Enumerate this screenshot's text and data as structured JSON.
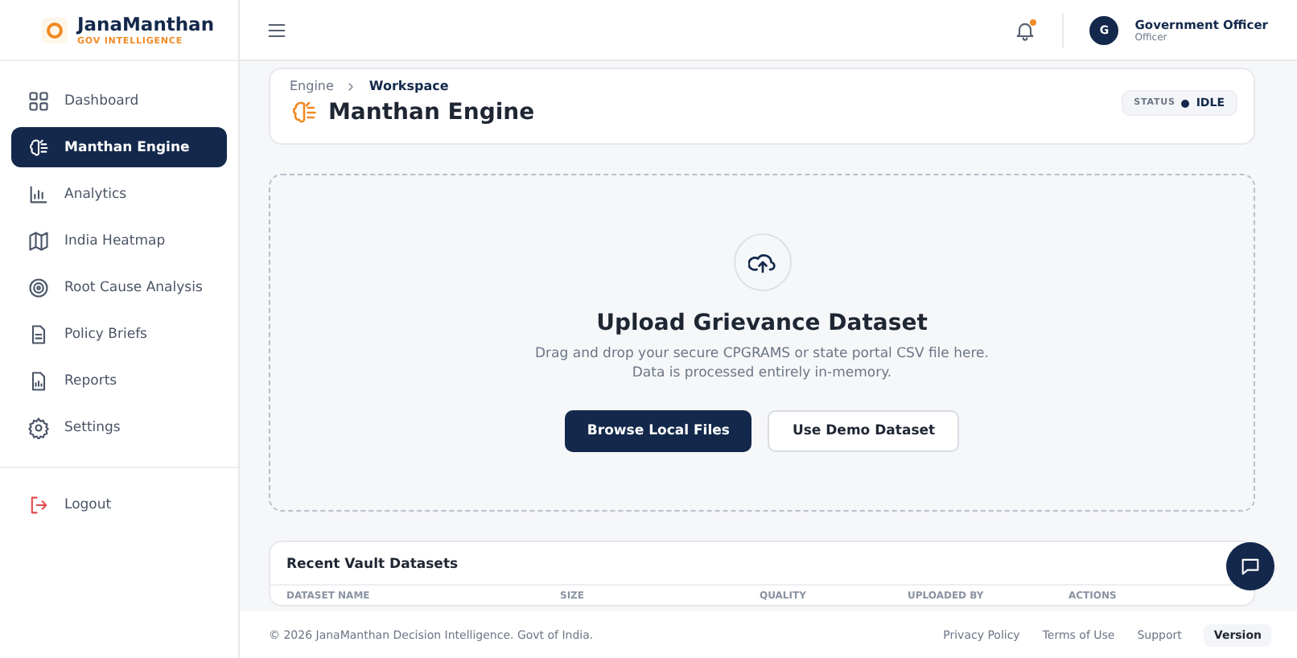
{
  "brand": {
    "name": "JanaManthan",
    "tagline": "GOV INTELLIGENCE"
  },
  "sidebar": {
    "items": [
      {
        "label": "Dashboard",
        "selected": false
      },
      {
        "label": "Manthan Engine",
        "selected": true
      },
      {
        "label": "Analytics",
        "selected": false
      },
      {
        "label": "India Heatmap",
        "selected": false
      },
      {
        "label": "Root Cause Analysis",
        "selected": false
      },
      {
        "label": "Policy Briefs",
        "selected": false
      },
      {
        "label": "Reports",
        "selected": false
      },
      {
        "label": "Settings",
        "selected": false
      }
    ],
    "logout": "Logout"
  },
  "header": {
    "notification": true,
    "user": {
      "initial": "G",
      "name": "Government Officer",
      "role": "Officer"
    }
  },
  "breadcrumb": [
    "Engine",
    "Workspace"
  ],
  "page_title": "Manthan Engine",
  "status": {
    "label": "STATUS",
    "value": "IDLE"
  },
  "upload": {
    "title": "Upload Grievance Dataset",
    "description": "Drag and drop your secure CPGRAMS or state portal CSV file here.",
    "note": "Data is processed entirely in-memory.",
    "buttons": [
      {
        "label": "Browse Local Files",
        "kind": "primary"
      },
      {
        "label": "Use Demo Dataset",
        "kind": "secondary"
      }
    ]
  },
  "recent": {
    "title": "Recent Vault Datasets",
    "columns": [
      "DATASET NAME",
      "SIZE",
      "QUALITY",
      "UPLOADED BY",
      "ACTIONS"
    ]
  },
  "footer": {
    "copyright": "© 2026 JanaManthan Decision Intelligence. Govt of India.",
    "links": [
      "Privacy Policy",
      "Terms of Use",
      "Support"
    ],
    "version": "Version"
  }
}
